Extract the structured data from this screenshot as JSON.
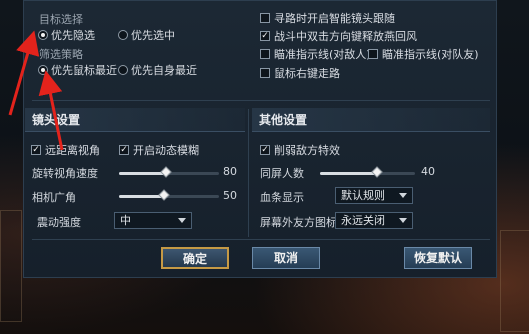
{
  "target_select": {
    "title": "目标选择",
    "options": [
      "优先隐选",
      "优先选中"
    ]
  },
  "filter_strategy": {
    "title": "筛选策略",
    "options": [
      "优先鼠标最近",
      "优先自身最近"
    ]
  },
  "right_options": [
    {
      "label": "寻路时开启智能镜头跟随",
      "checked": false
    },
    {
      "label": "战斗中双击方向键释放燕回风",
      "checked": true
    },
    {
      "label": "瞄准指示线(对敌人)",
      "checked": false
    },
    {
      "label": "瞄准指示线(对队友)",
      "checked": false
    },
    {
      "label": "鼠标右键走路",
      "checked": false
    }
  ],
  "camera": {
    "title": "镜头设置",
    "far_view": "远距离视角",
    "motion_blur": "开启动态模糊",
    "rotation_label": "旋转视角速度",
    "rotation_value": "80",
    "fov_label": "相机广角",
    "fov_value": "50",
    "shake_label": "震动强度",
    "shake_value": "中"
  },
  "other": {
    "title": "其他设置",
    "weaken_effects": "削弱敌方特效",
    "same_screen_label": "同屏人数",
    "same_screen_value": "40",
    "hp_bar_label": "血条显示",
    "hp_bar_value": "默认规则",
    "offscreen_label": "屏幕外友方图标",
    "offscreen_value": "永远关闭"
  },
  "buttons": {
    "confirm": "确定",
    "cancel": "取消",
    "restore": "恢复默认"
  },
  "colors": {
    "accent_gold": "#c69a45",
    "annotation_red": "#e3231c"
  }
}
